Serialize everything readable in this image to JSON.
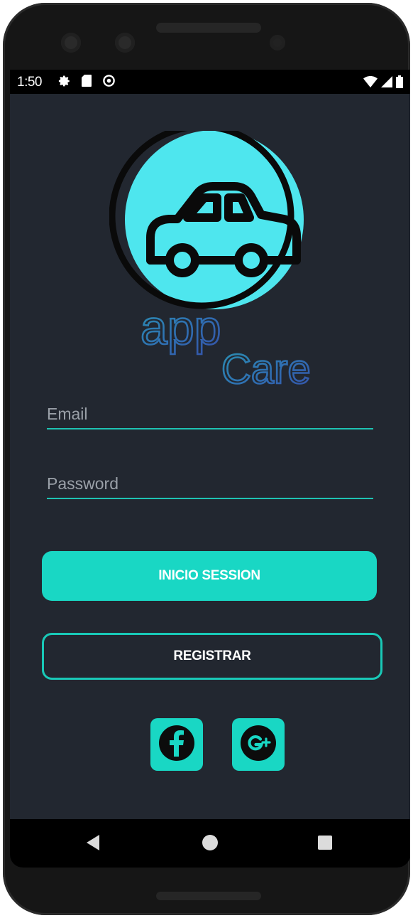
{
  "status_bar": {
    "time": "1:50",
    "left_icons": [
      "gear-icon",
      "sd-card-icon",
      "data-saver-icon"
    ],
    "right_icons": [
      "wifi-icon",
      "signal-icon",
      "battery-icon"
    ]
  },
  "logo": {
    "icon": "car-icon",
    "word_primary": "app",
    "word_secondary": "Care"
  },
  "form": {
    "email_placeholder": "Email",
    "password_placeholder": "Password"
  },
  "buttons": {
    "login_label": "INICIO SESSION",
    "register_label": "REGISTRAR"
  },
  "social": {
    "facebook_icon": "facebook-icon",
    "google_icon": "google-plus-icon"
  },
  "nav": {
    "back_icon": "back-icon",
    "home_icon": "home-icon",
    "recents_icon": "recents-icon"
  },
  "colors": {
    "screen_bg": "#222730",
    "accent": "#19d7c4",
    "logo_circle": "#4ee6ee",
    "text": "#ffffff"
  }
}
